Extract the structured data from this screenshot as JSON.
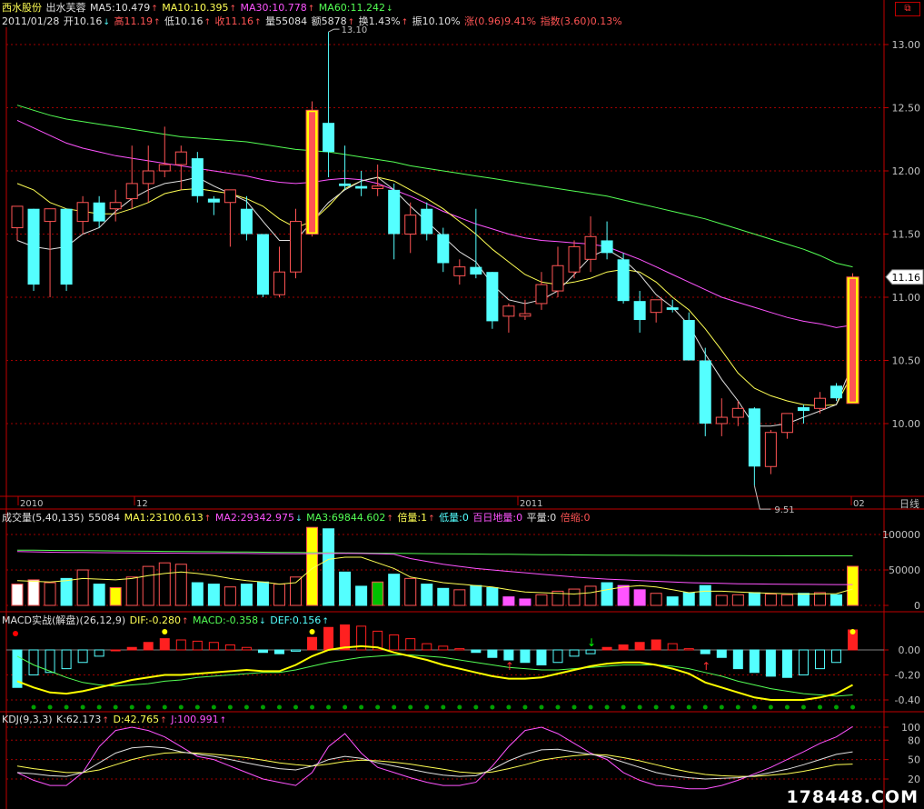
{
  "header": {
    "stock_name": "西水股份",
    "indicator": "出水芙蓉",
    "ma5": "MA5:10.479",
    "ma10": "MA10:10.395",
    "ma30": "MA30:10.778",
    "ma60": "MA60:11.242",
    "date": "2011/01/28",
    "open": "开10.16",
    "high": "高11.19",
    "low": "低10.16",
    "close": "收11.16",
    "volume": "量55084",
    "amount": "额5878",
    "turnover": "换1.43%",
    "amplitude": "振10.10%",
    "change": "涨(0.96)9.41%",
    "index": "指数(3.60)0.13%"
  },
  "corner_icon": "restore-icon",
  "colors": {
    "up": "#ff5454",
    "down": "#54ffff",
    "ma5": "#e0e0e0",
    "ma10": "#ffff54",
    "ma30": "#ff54ff",
    "ma60": "#54ff54",
    "grid": "#a00000",
    "axis": "#c00000"
  },
  "price_axis": {
    "ticks": [
      "13.00",
      "12.50",
      "12.00",
      "11.50",
      "11.00",
      "10.50",
      "10.00"
    ],
    "current_label": "11.16",
    "max_label": "13.10",
    "min_label": "9.51"
  },
  "time_axis": {
    "labels": [
      "2010",
      "12",
      "2011",
      "02"
    ],
    "period_label": "日线"
  },
  "volume_header": {
    "title": "成交量(5,40,135)",
    "vol": "55084",
    "ma1": "MA1:23100.613",
    "ma2": "MA2:29342.975",
    "ma3": "MA3:69844.602",
    "bei": "倍量:1",
    "di": "低量:0",
    "bairi": "百日地量:0",
    "ping": "平量:0",
    "beisuo": "倍缩:0"
  },
  "volume_axis": {
    "ticks": [
      "100000",
      "50000",
      "0"
    ]
  },
  "macd_header": {
    "title": "MACD实战(解盘)(26,12,9)",
    "dif": "DIF:-0.280",
    "macd": "MACD:-0.358",
    "def": "DEF:0.156"
  },
  "macd_axis": {
    "ticks": [
      "0.00",
      "-0.20",
      "-0.40"
    ]
  },
  "kdj_header": {
    "title": "KDJ(9,3,3)",
    "k": "K:62.173",
    "d": "D:42.765",
    "j": "J:100.991"
  },
  "kdj_axis": {
    "ticks": [
      "100",
      "80",
      "50",
      "20"
    ]
  },
  "watermark": "178448.COM",
  "chart_data": {
    "type": "candlestick",
    "price_range": [
      9.4,
      13.2
    ],
    "candles": [
      {
        "o": 11.55,
        "h": 11.7,
        "l": 11.45,
        "c": 11.72
      },
      {
        "o": 11.7,
        "h": 11.7,
        "l": 11.05,
        "c": 11.1
      },
      {
        "o": 11.6,
        "h": 11.7,
        "l": 11.0,
        "c": 11.7
      },
      {
        "o": 11.7,
        "h": 11.7,
        "l": 11.05,
        "c": 11.1
      },
      {
        "o": 11.6,
        "h": 11.8,
        "l": 11.5,
        "c": 11.75
      },
      {
        "o": 11.75,
        "h": 11.8,
        "l": 11.55,
        "c": 11.6
      },
      {
        "o": 11.7,
        "h": 11.85,
        "l": 11.6,
        "c": 11.75
      },
      {
        "o": 11.78,
        "h": 12.2,
        "l": 11.7,
        "c": 11.9
      },
      {
        "o": 11.9,
        "h": 12.2,
        "l": 11.75,
        "c": 12.0
      },
      {
        "o": 12.0,
        "h": 12.35,
        "l": 11.95,
        "c": 12.05
      },
      {
        "o": 12.05,
        "h": 12.2,
        "l": 11.85,
        "c": 12.15
      },
      {
        "o": 12.1,
        "h": 12.15,
        "l": 11.75,
        "c": 11.8
      },
      {
        "o": 11.78,
        "h": 11.8,
        "l": 11.65,
        "c": 11.75
      },
      {
        "o": 11.75,
        "h": 11.85,
        "l": 11.4,
        "c": 11.85
      },
      {
        "o": 11.7,
        "h": 11.8,
        "l": 11.45,
        "c": 11.5
      },
      {
        "o": 11.5,
        "h": 11.5,
        "l": 11.0,
        "c": 11.02
      },
      {
        "o": 11.02,
        "h": 11.4,
        "l": 11.0,
        "c": 11.2
      },
      {
        "o": 11.2,
        "h": 11.7,
        "l": 11.15,
        "c": 11.6
      },
      {
        "o": 11.5,
        "h": 12.55,
        "l": 11.48,
        "c": 12.48
      },
      {
        "o": 12.38,
        "h": 13.1,
        "l": 11.95,
        "c": 12.15
      },
      {
        "o": 11.9,
        "h": 12.2,
        "l": 11.85,
        "c": 11.88
      },
      {
        "o": 11.88,
        "h": 12.0,
        "l": 11.8,
        "c": 11.86
      },
      {
        "o": 11.86,
        "h": 12.05,
        "l": 11.8,
        "c": 11.88
      },
      {
        "o": 11.85,
        "h": 11.9,
        "l": 11.3,
        "c": 11.5
      },
      {
        "o": 11.5,
        "h": 11.75,
        "l": 11.35,
        "c": 11.65
      },
      {
        "o": 11.7,
        "h": 11.75,
        "l": 11.45,
        "c": 11.5
      },
      {
        "o": 11.5,
        "h": 11.55,
        "l": 11.2,
        "c": 11.27
      },
      {
        "o": 11.17,
        "h": 11.3,
        "l": 11.1,
        "c": 11.24
      },
      {
        "o": 11.24,
        "h": 11.7,
        "l": 11.15,
        "c": 11.18
      },
      {
        "o": 11.2,
        "h": 11.2,
        "l": 10.75,
        "c": 10.81
      },
      {
        "o": 10.85,
        "h": 10.95,
        "l": 10.72,
        "c": 10.93
      },
      {
        "o": 10.85,
        "h": 10.98,
        "l": 10.82,
        "c": 10.87
      },
      {
        "o": 10.95,
        "h": 11.2,
        "l": 10.9,
        "c": 11.1
      },
      {
        "o": 11.05,
        "h": 11.4,
        "l": 11.0,
        "c": 11.25
      },
      {
        "o": 11.2,
        "h": 11.45,
        "l": 11.15,
        "c": 11.4
      },
      {
        "o": 11.3,
        "h": 11.64,
        "l": 11.2,
        "c": 11.48
      },
      {
        "o": 11.45,
        "h": 11.6,
        "l": 11.3,
        "c": 11.35
      },
      {
        "o": 11.3,
        "h": 11.35,
        "l": 10.95,
        "c": 10.97
      },
      {
        "o": 10.97,
        "h": 11.05,
        "l": 10.72,
        "c": 10.82
      },
      {
        "o": 10.88,
        "h": 10.98,
        "l": 10.8,
        "c": 10.98
      },
      {
        "o": 10.92,
        "h": 10.98,
        "l": 10.88,
        "c": 10.9
      },
      {
        "o": 10.82,
        "h": 10.88,
        "l": 10.5,
        "c": 10.5
      },
      {
        "o": 10.5,
        "h": 10.6,
        "l": 9.9,
        "c": 10.0
      },
      {
        "o": 10.0,
        "h": 10.2,
        "l": 9.9,
        "c": 10.05
      },
      {
        "o": 10.05,
        "h": 10.18,
        "l": 9.98,
        "c": 10.12
      },
      {
        "o": 10.12,
        "h": 10.13,
        "l": 9.51,
        "c": 9.66
      },
      {
        "o": 9.66,
        "h": 9.95,
        "l": 9.6,
        "c": 9.93
      },
      {
        "o": 9.93,
        "h": 10.08,
        "l": 9.88,
        "c": 10.08
      },
      {
        "o": 10.13,
        "h": 10.15,
        "l": 10.0,
        "c": 10.1
      },
      {
        "o": 10.12,
        "h": 10.25,
        "l": 10.08,
        "c": 10.2
      },
      {
        "o": 10.3,
        "h": 10.32,
        "l": 10.18,
        "c": 10.2
      },
      {
        "o": 10.16,
        "h": 11.19,
        "l": 10.16,
        "c": 11.16
      }
    ],
    "ma5": [
      11.45,
      11.4,
      11.38,
      11.4,
      11.5,
      11.55,
      11.68,
      11.78,
      11.85,
      11.9,
      11.92,
      11.95,
      11.88,
      11.82,
      11.76,
      11.6,
      11.45,
      11.45,
      11.6,
      11.75,
      11.85,
      11.92,
      11.95,
      11.85,
      11.72,
      11.6,
      11.48,
      11.36,
      11.28,
      11.1,
      10.98,
      10.95,
      10.98,
      11.05,
      11.18,
      11.32,
      11.38,
      11.3,
      11.18,
      11.02,
      10.92,
      10.78,
      10.55,
      10.35,
      10.18,
      9.98,
      9.98,
      10.0,
      10.05,
      10.1,
      10.15,
      10.48
    ],
    "ma10": [
      11.9,
      11.85,
      11.75,
      11.7,
      11.68,
      11.66,
      11.66,
      11.7,
      11.75,
      11.82,
      11.85,
      11.86,
      11.84,
      11.82,
      11.78,
      11.72,
      11.62,
      11.55,
      11.6,
      11.72,
      11.86,
      11.92,
      11.95,
      11.92,
      11.85,
      11.78,
      11.7,
      11.6,
      11.5,
      11.38,
      11.28,
      11.18,
      11.12,
      11.1,
      11.12,
      11.15,
      11.2,
      11.22,
      11.2,
      11.12,
      11.0,
      10.9,
      10.75,
      10.58,
      10.4,
      10.28,
      10.22,
      10.18,
      10.15,
      10.14,
      10.15,
      10.4
    ],
    "ma30": [
      12.4,
      12.34,
      12.28,
      12.22,
      12.18,
      12.15,
      12.12,
      12.1,
      12.08,
      12.06,
      12.04,
      12.02,
      12.0,
      11.98,
      11.96,
      11.93,
      11.91,
      11.9,
      11.91,
      11.93,
      11.94,
      11.93,
      11.9,
      11.85,
      11.8,
      11.74,
      11.68,
      11.63,
      11.58,
      11.54,
      11.5,
      11.47,
      11.45,
      11.44,
      11.43,
      11.42,
      11.4,
      11.35,
      11.3,
      11.24,
      11.18,
      11.12,
      11.06,
      11.0,
      10.96,
      10.92,
      10.88,
      10.84,
      10.81,
      10.79,
      10.76,
      10.78
    ],
    "ma60": [
      12.52,
      12.48,
      12.44,
      12.41,
      12.39,
      12.37,
      12.35,
      12.33,
      12.31,
      12.29,
      12.27,
      12.26,
      12.25,
      12.24,
      12.23,
      12.21,
      12.19,
      12.17,
      12.16,
      12.15,
      12.13,
      12.11,
      12.09,
      12.07,
      12.04,
      12.02,
      12.0,
      11.98,
      11.96,
      11.94,
      11.92,
      11.9,
      11.88,
      11.86,
      11.84,
      11.82,
      11.8,
      11.77,
      11.74,
      11.71,
      11.68,
      11.65,
      11.62,
      11.58,
      11.54,
      11.5,
      11.46,
      11.42,
      11.38,
      11.33,
      11.27,
      11.24
    ],
    "volume": [
      30000,
      36000,
      32000,
      38000,
      50000,
      30000,
      25000,
      40000,
      55000,
      60000,
      58000,
      32000,
      30000,
      26000,
      30000,
      33000,
      30000,
      40000,
      110000,
      108000,
      47000,
      27000,
      33000,
      44000,
      38000,
      30000,
      24000,
      22000,
      28000,
      25000,
      12000,
      9000,
      15000,
      20000,
      23000,
      27000,
      32000,
      28000,
      22000,
      17000,
      12000,
      18000,
      28000,
      14000,
      15000,
      18000,
      16000,
      15000,
      17000,
      18000,
      15000,
      55084
    ],
    "vol_ma1": [
      35000,
      34000,
      33000,
      35000,
      38000,
      37000,
      36000,
      38000,
      42000,
      45000,
      47000,
      45000,
      42000,
      38000,
      35000,
      33000,
      30000,
      32000,
      52000,
      65000,
      68000,
      68000,
      60000,
      52000,
      40000,
      36000,
      32000,
      30000,
      28000,
      26000,
      22000,
      19000,
      18000,
      17000,
      16000,
      18000,
      22000,
      26000,
      28000,
      26000,
      22000,
      18000,
      20000,
      20000,
      19000,
      18000,
      17000,
      16500,
      16000,
      16200,
      16500,
      23100
    ],
    "vol_ma2": [
      76000,
      75500,
      75000,
      74800,
      74600,
      74400,
      74200,
      74000,
      73800,
      73700,
      73600,
      73500,
      73400,
      73300,
      73200,
      73000,
      72900,
      72800,
      73000,
      73200,
      73300,
      73200,
      72800,
      72000,
      66000,
      62000,
      58000,
      55000,
      52000,
      50000,
      48000,
      46000,
      44000,
      42000,
      40000,
      38500,
      37000,
      36000,
      35000,
      34000,
      33000,
      32000,
      31500,
      31000,
      30500,
      30200,
      30000,
      29800,
      29600,
      29500,
      29400,
      29343
    ],
    "vol_ma3": [
      78000,
      77800,
      77600,
      77400,
      77200,
      77000,
      76800,
      76600,
      76400,
      76200,
      76000,
      75800,
      75600,
      75400,
      75200,
      75000,
      74800,
      74600,
      74400,
      74200,
      74000,
      73800,
      73600,
      73400,
      73200,
      73000,
      72800,
      72600,
      72400,
      72200,
      72000,
      71800,
      71600,
      71400,
      71200,
      71000,
      70900,
      70800,
      70700,
      70600,
      70500,
      70400,
      70300,
      70200,
      70100,
      70000,
      69950,
      69900,
      69880,
      69860,
      69850,
      69845
    ],
    "macd_hist": [
      -0.3,
      -0.2,
      -0.18,
      -0.15,
      -0.1,
      -0.05,
      0.0,
      0.02,
      0.06,
      0.09,
      0.08,
      0.07,
      0.06,
      0.04,
      0.02,
      -0.02,
      -0.03,
      -0.01,
      0.1,
      0.18,
      0.2,
      0.19,
      0.15,
      0.12,
      0.09,
      0.05,
      0.03,
      0.01,
      -0.02,
      -0.06,
      -0.08,
      -0.1,
      -0.12,
      -0.1,
      -0.05,
      -0.03,
      0.02,
      0.04,
      0.06,
      0.08,
      0.05,
      0.01,
      -0.03,
      -0.06,
      -0.15,
      -0.18,
      -0.21,
      -0.22,
      -0.2,
      -0.15,
      -0.1,
      0.16
    ],
    "macd_dif": [
      -0.25,
      -0.3,
      -0.34,
      -0.35,
      -0.33,
      -0.3,
      -0.27,
      -0.24,
      -0.22,
      -0.2,
      -0.2,
      -0.19,
      -0.18,
      -0.17,
      -0.16,
      -0.17,
      -0.17,
      -0.12,
      -0.05,
      0.0,
      0.02,
      0.03,
      0.02,
      -0.02,
      -0.05,
      -0.08,
      -0.12,
      -0.15,
      -0.18,
      -0.21,
      -0.23,
      -0.23,
      -0.22,
      -0.19,
      -0.16,
      -0.13,
      -0.11,
      -0.1,
      -0.1,
      -0.12,
      -0.15,
      -0.19,
      -0.26,
      -0.3,
      -0.34,
      -0.38,
      -0.4,
      -0.4,
      -0.4,
      -0.38,
      -0.35,
      -0.28
    ],
    "macd_dea": [
      -0.05,
      -0.12,
      -0.17,
      -0.22,
      -0.26,
      -0.28,
      -0.29,
      -0.28,
      -0.27,
      -0.25,
      -0.24,
      -0.22,
      -0.21,
      -0.2,
      -0.19,
      -0.18,
      -0.18,
      -0.16,
      -0.13,
      -0.1,
      -0.08,
      -0.06,
      -0.05,
      -0.04,
      -0.04,
      -0.05,
      -0.06,
      -0.08,
      -0.1,
      -0.12,
      -0.14,
      -0.15,
      -0.16,
      -0.16,
      -0.15,
      -0.14,
      -0.13,
      -0.12,
      -0.12,
      -0.12,
      -0.13,
      -0.15,
      -0.18,
      -0.21,
      -0.25,
      -0.28,
      -0.31,
      -0.33,
      -0.35,
      -0.36,
      -0.37,
      -0.36
    ],
    "kdj_k": [
      30,
      28,
      25,
      24,
      30,
      45,
      60,
      68,
      70,
      68,
      62,
      58,
      55,
      50,
      45,
      40,
      36,
      34,
      40,
      50,
      55,
      52,
      45,
      40,
      35,
      30,
      26,
      24,
      25,
      35,
      48,
      58,
      65,
      66,
      62,
      58,
      54,
      46,
      38,
      30,
      25,
      22,
      20,
      21,
      22,
      25,
      30,
      35,
      42,
      50,
      58,
      62
    ],
    "kdj_d": [
      40,
      36,
      33,
      30,
      30,
      34,
      42,
      50,
      56,
      60,
      61,
      60,
      58,
      56,
      53,
      49,
      45,
      42,
      40,
      43,
      47,
      49,
      48,
      46,
      43,
      39,
      35,
      31,
      29,
      31,
      36,
      42,
      49,
      53,
      56,
      58,
      57,
      53,
      48,
      42,
      36,
      31,
      27,
      25,
      24,
      24,
      26,
      28,
      32,
      37,
      42,
      43
    ],
    "kdj_j": [
      30,
      18,
      10,
      10,
      30,
      70,
      95,
      100,
      95,
      85,
      70,
      55,
      50,
      40,
      30,
      20,
      15,
      10,
      30,
      70,
      90,
      60,
      38,
      30,
      22,
      15,
      10,
      10,
      15,
      40,
      70,
      95,
      100,
      90,
      75,
      60,
      50,
      30,
      18,
      10,
      8,
      5,
      5,
      10,
      18,
      28,
      38,
      50,
      62,
      75,
      85,
      101
    ]
  }
}
